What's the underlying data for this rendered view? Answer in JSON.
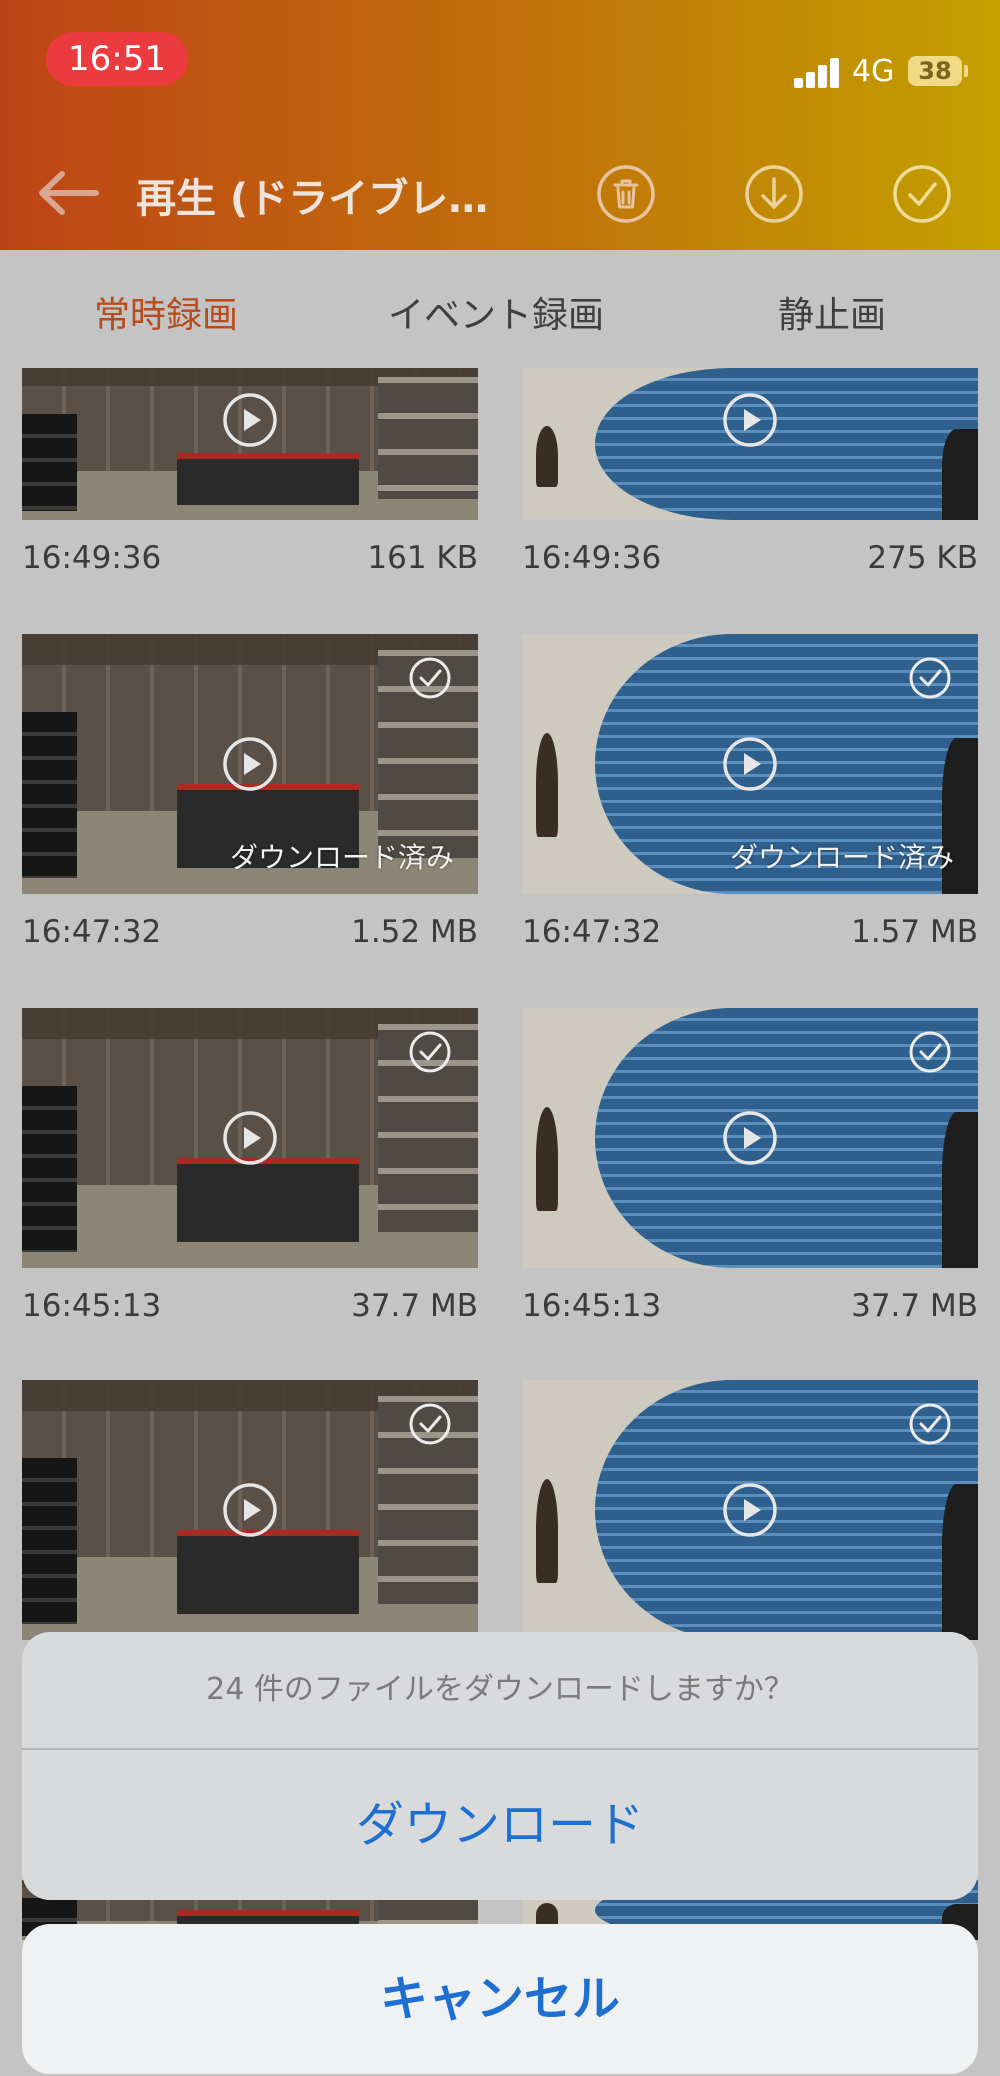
{
  "status_bar": {
    "time": "16:51",
    "network": "4G",
    "battery": "38"
  },
  "header": {
    "title": "再生 (ドライブレ…",
    "icons": [
      "arrow-left-icon",
      "trash-icon",
      "download-icon",
      "check-icon"
    ]
  },
  "tabs": [
    {
      "label": "常時録画",
      "active": true
    },
    {
      "label": "イベント録画",
      "active": false
    },
    {
      "label": "静止画",
      "active": false
    }
  ],
  "grid": [
    {
      "time": "16:49:36",
      "size": "161 KB",
      "downloaded": false,
      "downloaded_label": ""
    },
    {
      "time": "16:49:36",
      "size": "275 KB",
      "downloaded": false,
      "downloaded_label": ""
    },
    {
      "time": "16:47:32",
      "size": "1.52 MB",
      "downloaded": true,
      "downloaded_label": "ダウンロード済み"
    },
    {
      "time": "16:47:32",
      "size": "1.57 MB",
      "downloaded": true,
      "downloaded_label": "ダウンロード済み"
    },
    {
      "time": "16:45:13",
      "size": "37.7 MB",
      "downloaded": false,
      "downloaded_label": ""
    },
    {
      "time": "16:45:13",
      "size": "37.7 MB",
      "downloaded": false,
      "downloaded_label": ""
    }
  ],
  "action_sheet": {
    "message": "24 件のファイルをダウンロードしますか？",
    "confirm_label": "ダウンロード",
    "cancel_label": "キャンセル"
  },
  "colors": {
    "header_start": "#be4416",
    "header_end": "#c3a000",
    "active_tab": "#b64c1c",
    "action_blue": "#1f6fd1"
  }
}
